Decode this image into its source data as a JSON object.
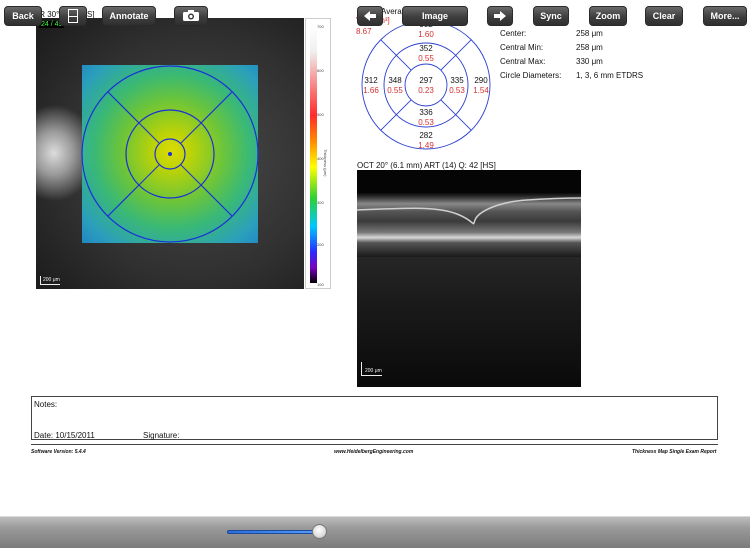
{
  "fundus": {
    "title": "IR 30° ART [HS]",
    "badge": "24 / 49",
    "scale_label": "200 μm"
  },
  "colorbar": {
    "ticks": [
      "700",
      "600",
      "500",
      "400",
      "300",
      "200",
      "100"
    ],
    "label": "Thickness (μm)"
  },
  "thickness": {
    "title": "Average Thickness [μm]",
    "vol_label": "Vol [mm³]",
    "vol_value": "8.67",
    "sectors": {
      "outer_superior": {
        "thick": "302",
        "vol": "1.60"
      },
      "inner_superior": {
        "thick": "352",
        "vol": "0.55"
      },
      "outer_temporal": {
        "thick": "312",
        "vol": "1.66"
      },
      "inner_temporal": {
        "thick": "348",
        "vol": "0.55"
      },
      "center": {
        "thick": "297",
        "vol": "0.23"
      },
      "inner_nasal": {
        "thick": "335",
        "vol": "0.53"
      },
      "outer_nasal": {
        "thick": "290",
        "vol": "1.54"
      },
      "inner_inferior": {
        "thick": "336",
        "vol": "0.53"
      },
      "outer_inferior": {
        "thick": "282",
        "vol": "1.49"
      }
    }
  },
  "stats": [
    {
      "label": "Center:",
      "value": "258 μm"
    },
    {
      "label": "Central Min:",
      "value": "258 μm"
    },
    {
      "label": "Central Max:",
      "value": "330 μm"
    },
    {
      "label": "Circle Diameters:",
      "value": "1, 3, 6 mm ETDRS"
    }
  ],
  "oct": {
    "title": "OCT 20° (6.1 mm) ART (14) Q: 42 [HS]",
    "scale_label": "200 μm"
  },
  "notes": {
    "label": "Notes:",
    "date": "Date: 10/15/2011",
    "signature": "Signature:"
  },
  "footer": {
    "software": "Software Version: 5.4.4",
    "website": "www.HeidelbergEngineering.com",
    "report": "Thickness Map Single Exam Report"
  },
  "toolbar": {
    "back": "Back",
    "annotate": "Annotate",
    "image": "Image",
    "sync": "Sync",
    "zoom": "Zoom",
    "clear": "Clear",
    "more": "More...",
    "slider_level": 0.92
  },
  "colors": {
    "accent_red": "#d63030",
    "grid_blue": "#2b3fd0",
    "slider_blue": "#2a6ed8"
  }
}
